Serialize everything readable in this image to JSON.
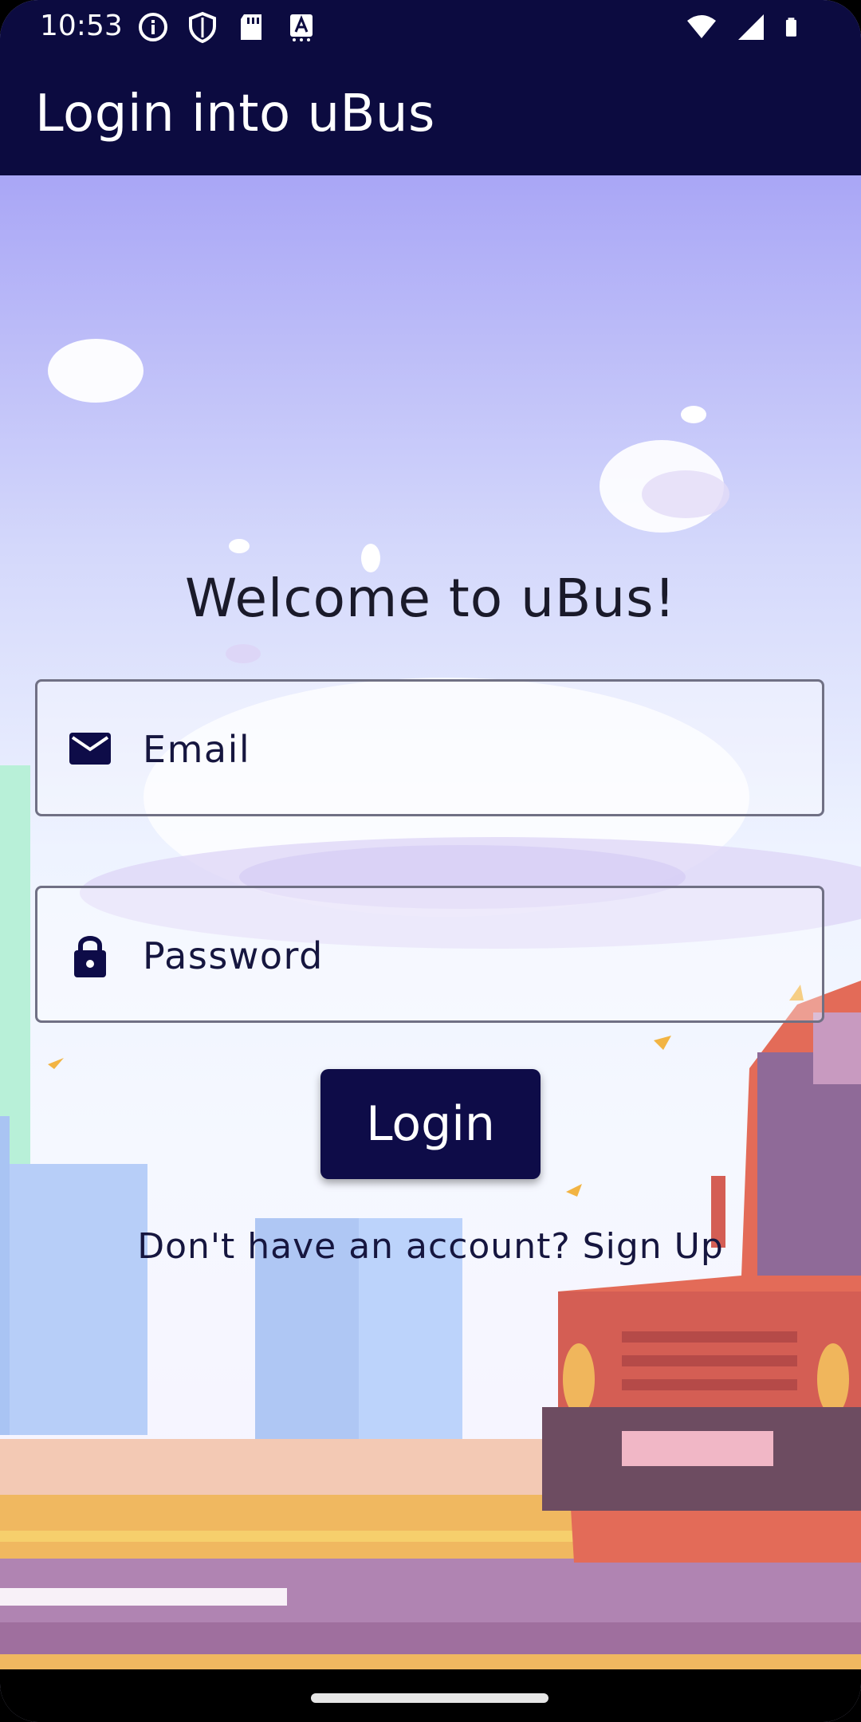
{
  "status_bar": {
    "time": "10:53",
    "left_icons": [
      "info-icon",
      "shield-icon",
      "sd-card-icon",
      "font-icon"
    ],
    "right_icons": [
      "wifi-icon",
      "signal-icon",
      "battery-icon"
    ]
  },
  "app_bar": {
    "title": "Login into uBus"
  },
  "login_form": {
    "welcome": "Welcome to uBus!",
    "email": {
      "label": "Email",
      "icon": "mail-icon"
    },
    "password": {
      "label": "Password",
      "icon": "lock-icon"
    },
    "login_label": "Login",
    "signup_prompt": "Don't have an account? Sign Up"
  },
  "colors": {
    "primary": "#0c0b40",
    "button": "#0e0c48",
    "text": "#16163f",
    "field_border": "#707084"
  }
}
